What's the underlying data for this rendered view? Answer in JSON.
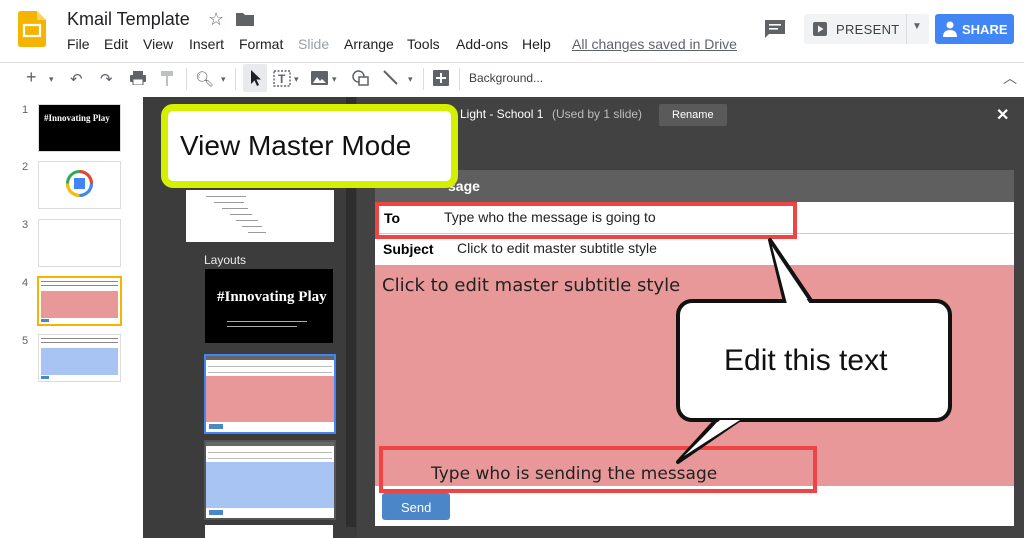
{
  "app": {
    "title": "Kmail Template",
    "saved_status": "All changes saved in Drive",
    "menu": [
      "File",
      "Edit",
      "View",
      "Insert",
      "Format",
      "Slide",
      "Arrange",
      "Tools",
      "Add-ons",
      "Help"
    ],
    "present_label": "PRESENT",
    "share_label": "SHARE"
  },
  "toolbar": {
    "background_label": "Background..."
  },
  "filmstrip": {
    "slides": [
      "1",
      "2",
      "3",
      "4",
      "5"
    ],
    "slide1_title": "#Innovating Play"
  },
  "master": {
    "theme_name": "Light - School 1",
    "used_by": "(Used by 1 slide)",
    "rename_label": "Rename",
    "layouts_label": "Layouts",
    "layout_logo_text": "#Innovating Play"
  },
  "slide": {
    "header": "sage",
    "to_label": "To",
    "to_value": "Type who the message is going to",
    "subject_label": "Subject",
    "subject_value": "Click to edit master subtitle style",
    "body_text": "Click to edit master subtitle style",
    "sender_text": "Type who is sending the message",
    "send_label": "Send"
  },
  "annotations": {
    "view_master_mode": "View Master Mode",
    "edit_this_text": "Edit this text"
  },
  "colors": {
    "accent_blue": "#4285f4",
    "highlight_yellow": "#d4f000",
    "annotation_red": "#ef4444",
    "body_pink": "#e89898"
  }
}
